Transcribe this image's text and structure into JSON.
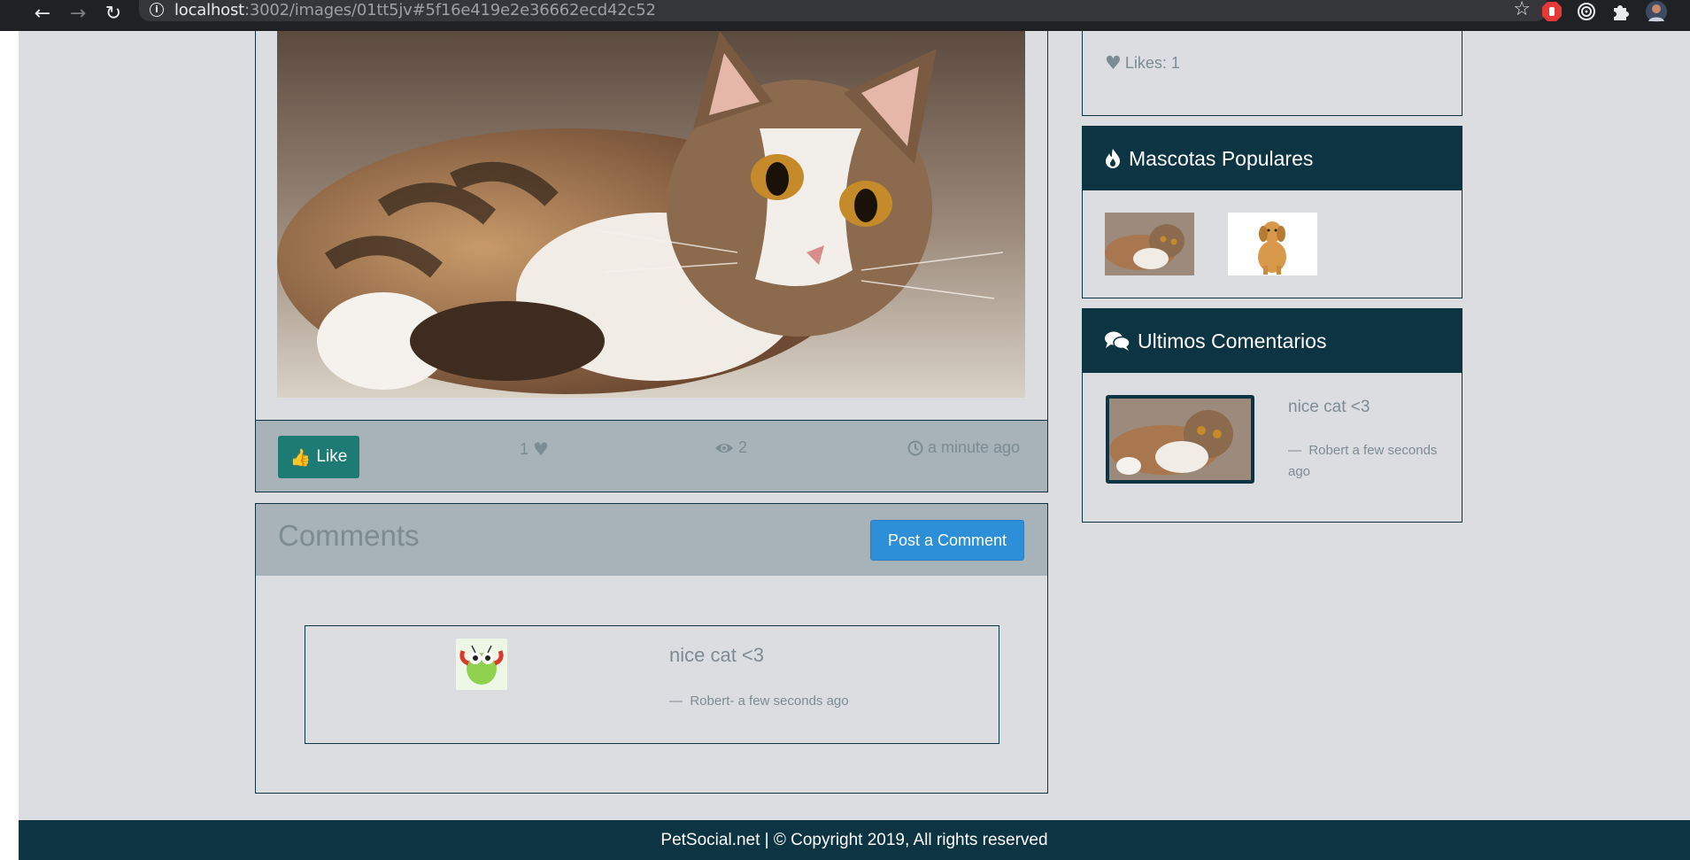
{
  "browser": {
    "url_host": "localhost",
    "url_path": ":3002/images/01tt5jv#5f16e419e2e36662ecd42c52",
    "back_icon": "arrow-left-icon",
    "forward_icon": "arrow-right-icon",
    "reload_icon": "reload-icon",
    "bookmark_icon": "star-icon"
  },
  "image_stats": {
    "like_label": "Like",
    "likes_count": "1",
    "views_count": "2",
    "posted": "a minute ago"
  },
  "comments": {
    "heading": "Comments",
    "post_button": "Post a Comment",
    "items": [
      {
        "text": "nice cat <3",
        "meta": "Robert- a few seconds ago"
      }
    ]
  },
  "sidebar": {
    "likes_label": "Likes: 1",
    "popular": {
      "title": "Mascotas Populares"
    },
    "recent": {
      "title": "Ultimos Comentarios",
      "items": [
        {
          "text": "nice cat <3",
          "meta": "Robert a few seconds ago"
        }
      ]
    }
  },
  "footer": {
    "text": "PetSocial.net | © Copyright 2019, All rights reserved"
  },
  "colors": {
    "page_bg": "#dcdde1",
    "header_dark": "#0c3442",
    "stats_bar": "#a7b2b9",
    "like_button": "#1d7b74",
    "post_button": "#2d8fd8",
    "muted_text": "#7d8b93"
  }
}
